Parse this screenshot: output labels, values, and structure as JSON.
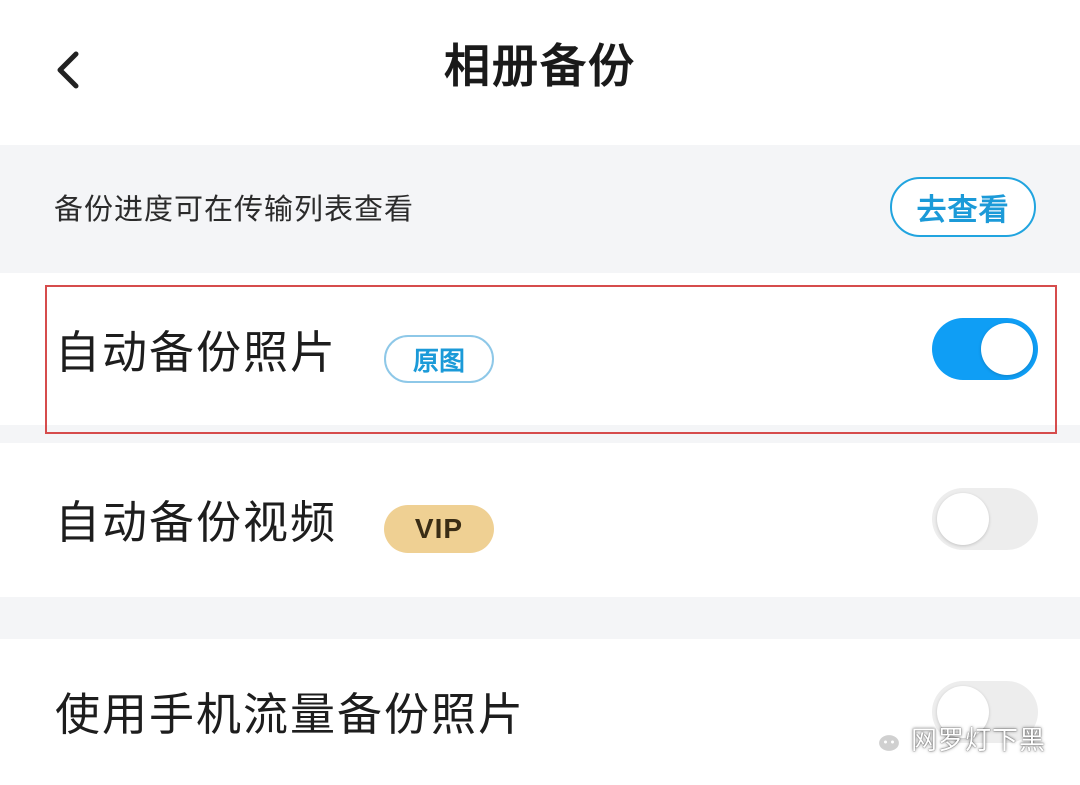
{
  "header": {
    "title": "相册备份",
    "back_icon": "chevron-left-icon"
  },
  "notice": {
    "text": "备份进度可在传输列表查看",
    "button_label": "去查看"
  },
  "settings": {
    "auto_photos": {
      "label": "自动备份照片",
      "badge": "原图",
      "enabled": true
    },
    "auto_videos": {
      "label": "自动备份视频",
      "badge": "VIP",
      "enabled": false
    },
    "mobile_data": {
      "label": "使用手机流量备份照片",
      "enabled": false
    }
  },
  "watermark": {
    "icon": "wechat-icon",
    "text": "网罗灯下黑"
  },
  "colors": {
    "accent": "#0f9ef5",
    "link": "#1b9ad8",
    "toggle_off": "#ededed",
    "section_bg": "#f4f5f7",
    "vip_badge": "#efd093",
    "highlight": "#d64c4c"
  }
}
